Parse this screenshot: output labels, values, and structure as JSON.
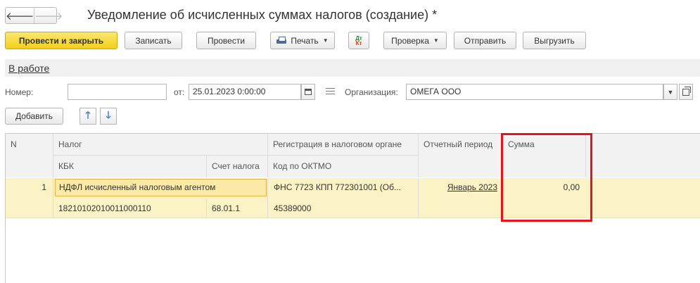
{
  "window": {
    "title": "Уведомление об исчисленных суммах налогов (создание) *"
  },
  "nav": {
    "back_glyph": "🡐",
    "forward_glyph": "🡒"
  },
  "toolbar": {
    "post_and_close": "Провести и закрыть",
    "save": "Записать",
    "post": "Провести",
    "print": "Печать",
    "dtkt_top": "Дт",
    "dtkt_bottom": "Кт",
    "check": "Проверка",
    "send": "Отправить",
    "export": "Выгрузить"
  },
  "status": {
    "label": "В работе"
  },
  "form": {
    "number_label": "Номер:",
    "number_value": "",
    "date_label": "от:",
    "date_value": "25.01.2023  0:00:00",
    "org_label": "Организация:",
    "org_value": "ОМЕГА ООО"
  },
  "table_toolbar": {
    "add": "Добавить"
  },
  "table": {
    "headers": {
      "n": "N",
      "tax": "Налог",
      "kbk": "КБК",
      "account": "Счет налога",
      "registration": "Регистрация в налоговом органе",
      "oktmo": "Код по ОКТМО",
      "period": "Отчетный период",
      "amount": "Сумма"
    },
    "rows": [
      {
        "n": "1",
        "tax": "НДФЛ исчисленный налоговым агентом",
        "kbk": "18210102010011000110",
        "account": "68.01.1",
        "registration": "ФНС 7723 КПП 772301001 (Об...",
        "oktmo": "45389000",
        "period": "Январь 2023",
        "amount": "0,00"
      }
    ]
  },
  "colors": {
    "primary_button": "#f2cf1a",
    "row_highlight": "#fbf2c6",
    "annotation_frame": "#e8141c"
  }
}
